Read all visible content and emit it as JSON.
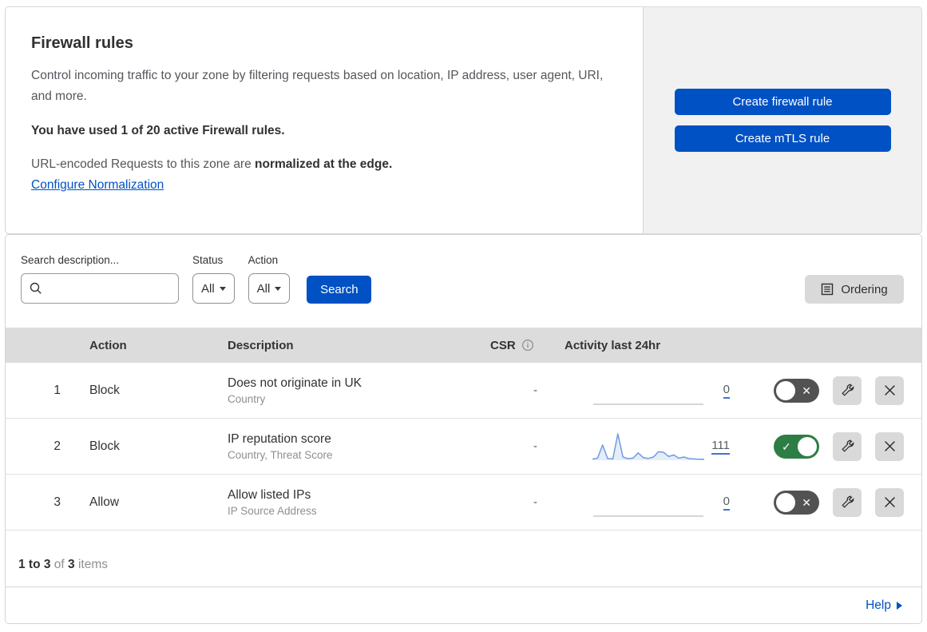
{
  "intro": {
    "title": "Firewall rules",
    "description": "Control incoming traffic to your zone by filtering requests based on location, IP address, user agent, URI, and more.",
    "usage": "You have used 1 of 20 active Firewall rules.",
    "normalization_text": "URL-encoded Requests to this zone are ",
    "normalization_bold": "normalized at the edge.",
    "normalization_link": "Configure Normalization"
  },
  "cta": {
    "create_firewall_rule": "Create firewall rule",
    "create_mtls_rule": "Create mTLS rule"
  },
  "filters": {
    "search_label": "Search description...",
    "search_value": "",
    "status_label": "Status",
    "status_value": "All",
    "action_label": "Action",
    "action_value": "All",
    "search_button": "Search",
    "ordering_button": "Ordering"
  },
  "table": {
    "headers": {
      "action": "Action",
      "description": "Description",
      "csr": "CSR",
      "activity": "Activity last 24hr"
    },
    "rows": [
      {
        "priority": "1",
        "action": "Block",
        "description": "Does not originate in UK",
        "expression": "Country",
        "csr": "-",
        "activity_count": "0",
        "enabled": false,
        "sparkline": []
      },
      {
        "priority": "2",
        "action": "Block",
        "description": "IP reputation score",
        "expression": "Country, Threat Score",
        "csr": "-",
        "activity_count": "111",
        "enabled": true,
        "sparkline": [
          4,
          8,
          58,
          6,
          5,
          100,
          12,
          6,
          8,
          28,
          10,
          7,
          12,
          32,
          30,
          14,
          20,
          8,
          12,
          6,
          5,
          4,
          4
        ]
      },
      {
        "priority": "3",
        "action": "Allow",
        "description": "Allow listed IPs",
        "expression": "IP Source Address",
        "csr": "-",
        "activity_count": "0",
        "enabled": false,
        "sparkline": []
      }
    ],
    "footer": {
      "range": "1 to 3",
      "of": "of",
      "total": "3",
      "items": "items"
    }
  },
  "help": {
    "label": "Help"
  },
  "icons": {
    "toggle_on": "✓",
    "toggle_off": "✕"
  },
  "colors": {
    "primary_blue": "#0051c3",
    "toggle_on_green": "#2d7e44",
    "toggle_off_gray": "#525252",
    "sparkline_blue": "#6f9ce0",
    "header_gray": "#dcdcdc"
  }
}
